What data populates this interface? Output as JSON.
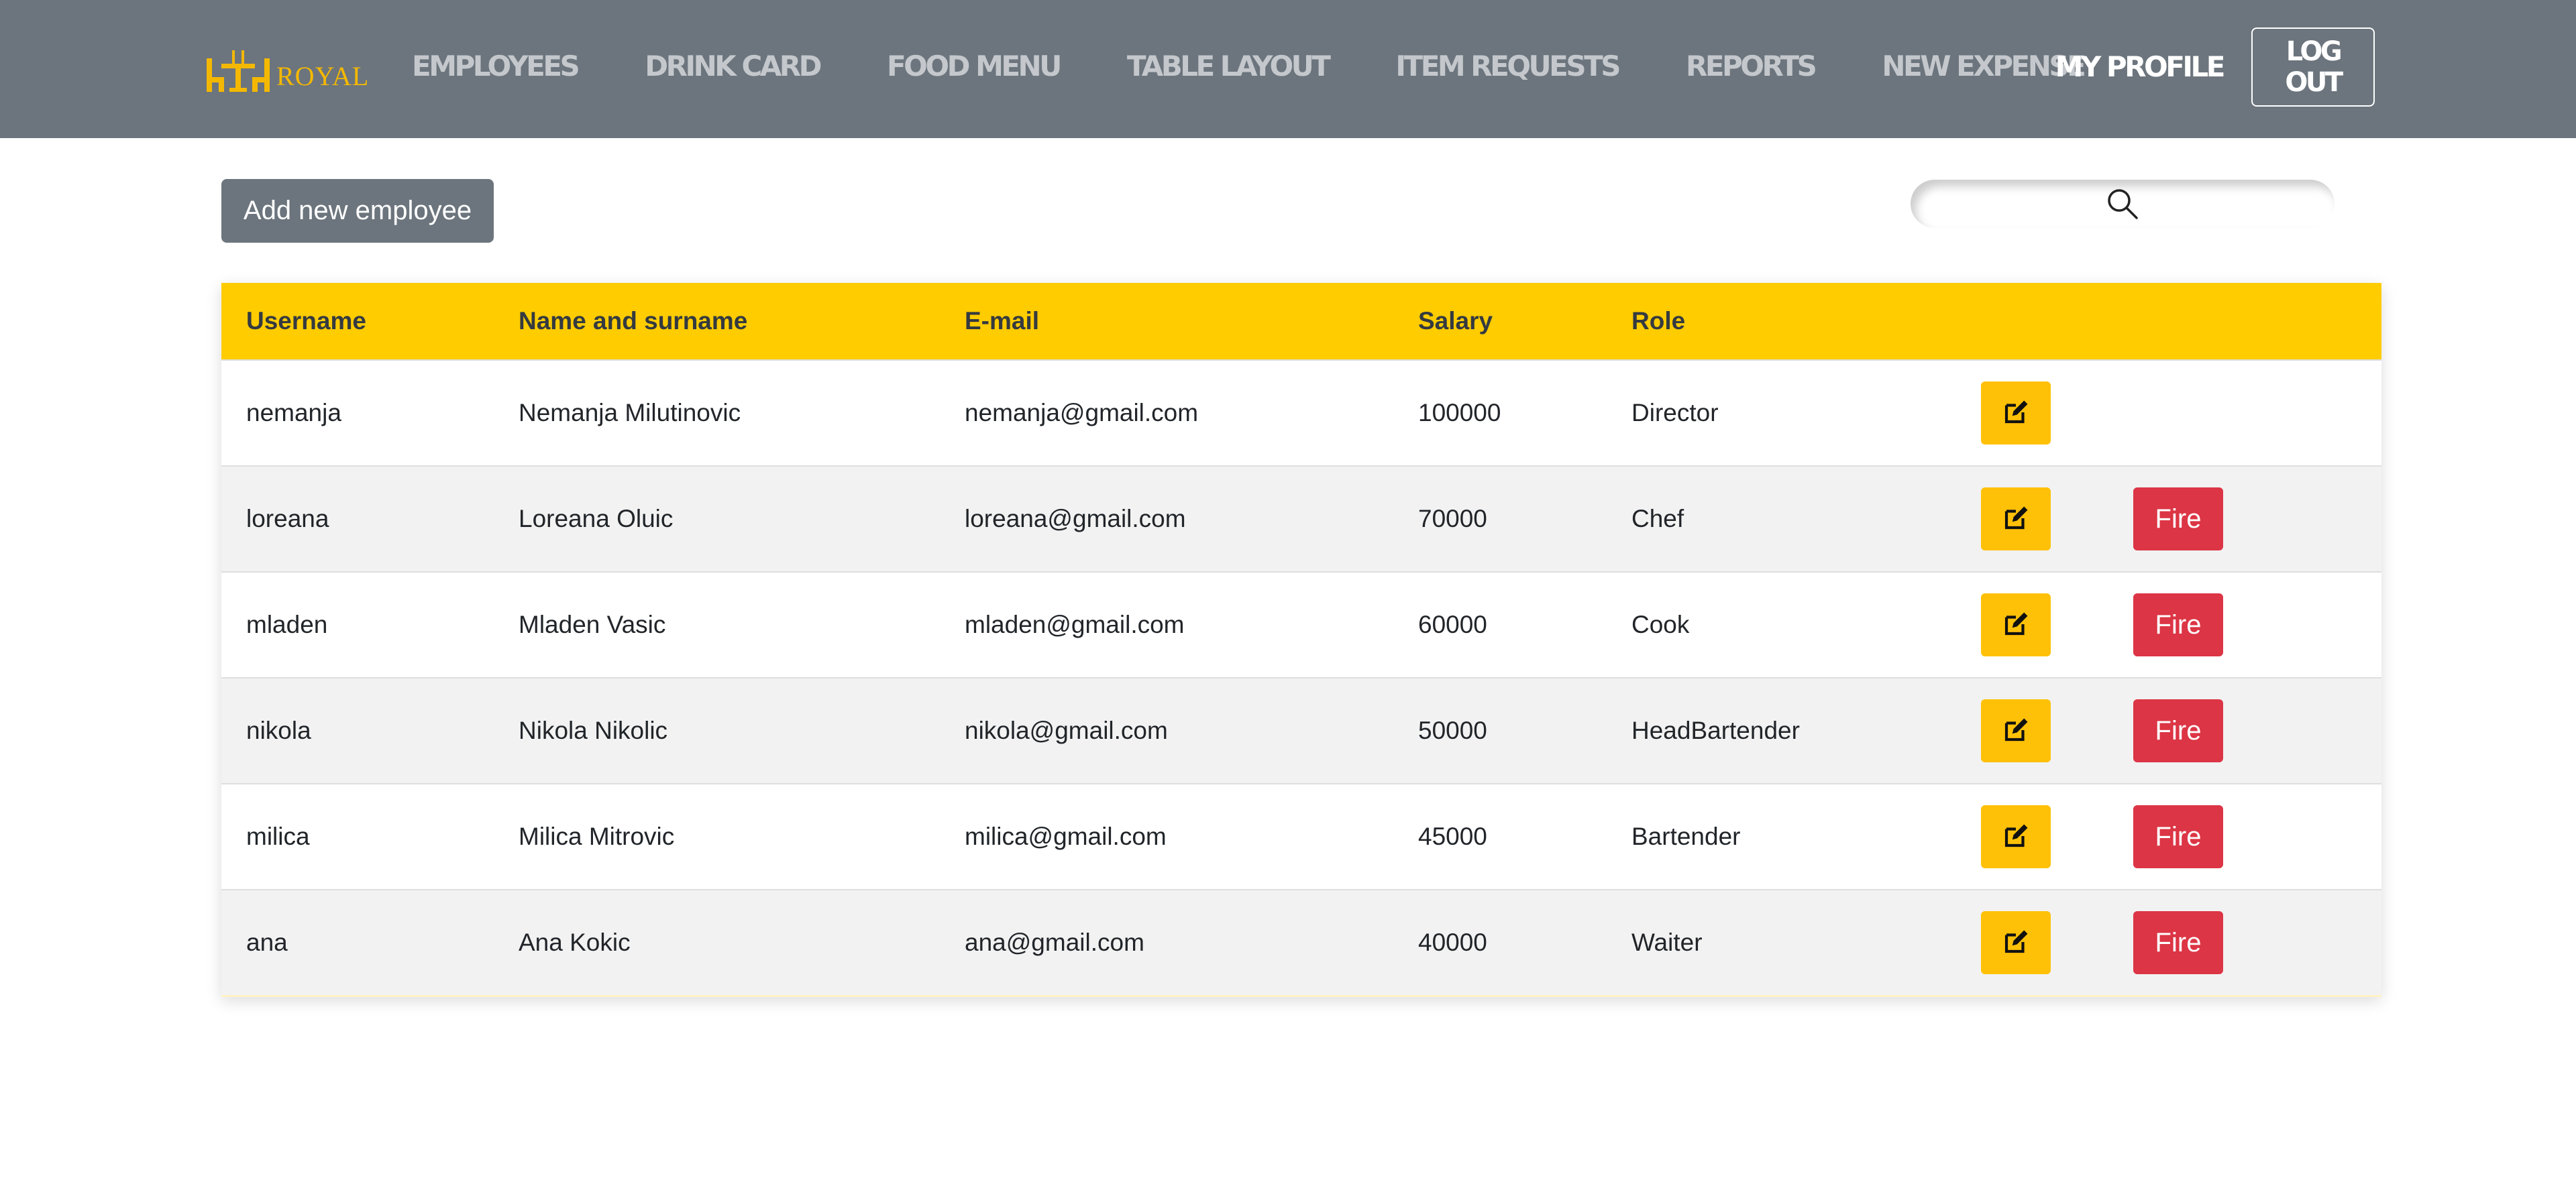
{
  "brand": {
    "name": "ROYAL",
    "color": "#f5b800"
  },
  "nav": {
    "links": [
      "EMPLOYEES",
      "DRINK CARD",
      "FOOD MENU",
      "TABLE LAYOUT",
      "ITEM REQUESTS",
      "REPORTS",
      "NEW EXPENSE"
    ],
    "profile": "MY PROFILE",
    "logout": "LOG OUT"
  },
  "toolbar": {
    "add_label": "Add new employee"
  },
  "search": {
    "placeholder": "",
    "value": ""
  },
  "table": {
    "headers": [
      "Username",
      "Name and surname",
      "E-mail",
      "Salary",
      "Role"
    ],
    "fire_label": "Fire",
    "rows": [
      {
        "username": "nemanja",
        "name": "Nemanja Milutinovic",
        "email": "nemanja@gmail.com",
        "salary": "100000",
        "role": "Director",
        "can_fire": false
      },
      {
        "username": "loreana",
        "name": "Loreana Oluic",
        "email": "loreana@gmail.com",
        "salary": "70000",
        "role": "Chef",
        "can_fire": true
      },
      {
        "username": "mladen",
        "name": "Mladen Vasic",
        "email": "mladen@gmail.com",
        "salary": "60000",
        "role": "Cook",
        "can_fire": true
      },
      {
        "username": "nikola",
        "name": "Nikola Nikolic",
        "email": "nikola@gmail.com",
        "salary": "50000",
        "role": "HeadBartender",
        "can_fire": true
      },
      {
        "username": "milica",
        "name": "Milica Mitrovic",
        "email": "milica@gmail.com",
        "salary": "45000",
        "role": "Bartender",
        "can_fire": true
      },
      {
        "username": "ana",
        "name": "Ana Kokic",
        "email": "ana@gmail.com",
        "salary": "40000",
        "role": "Waiter",
        "can_fire": true
      }
    ]
  },
  "icons": {
    "brand": "table-chairs-logo-icon",
    "search": "search-icon",
    "edit": "edit-icon"
  },
  "colors": {
    "navbar": "#6c757d",
    "header": "#ffcc00",
    "edit": "#ffc107",
    "fire": "#dc3545"
  }
}
